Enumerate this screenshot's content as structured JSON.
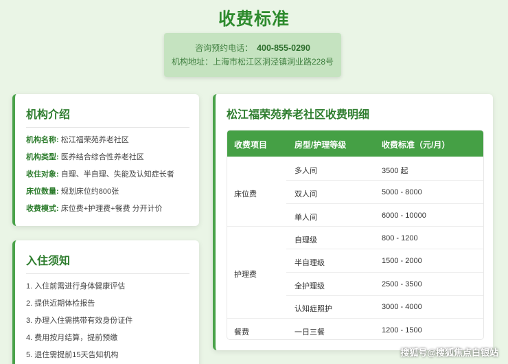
{
  "page_title": "收费标准",
  "contact": {
    "phone_label": "咨询预约电话：",
    "phone": "400-855-0290",
    "address_label": "机构地址：",
    "address": "上海市松江区洞泾镇洞业路228号"
  },
  "intro": {
    "title": "机构介绍",
    "rows": [
      {
        "key": "机构名称:",
        "value": "松江福荣苑养老社区"
      },
      {
        "key": "机构类型:",
        "value": "医养结合综合性养老社区"
      },
      {
        "key": "收住对象:",
        "value": "自理、半自理、失能及认知症长者"
      },
      {
        "key": "床位数量:",
        "value": "规划床位约800张"
      },
      {
        "key": "收费模式:",
        "value": "床位费+护理费+餐费 分开计价"
      }
    ]
  },
  "notice": {
    "title": "入住须知",
    "items": [
      "1. 入住前需进行身体健康评估",
      "2. 提供近期体检报告",
      "3. 办理入住需携带有效身份证件",
      "4. 费用按月结算，提前预缴",
      "5. 退住需提前15天告知机构"
    ]
  },
  "fees": {
    "title": "松江福荣苑养老社区收费明细",
    "headers": [
      "收费项目",
      "房型/护理等级",
      "收费标准（元/月）"
    ],
    "groups": [
      {
        "category": "床位费",
        "rows": [
          {
            "type": "多人间",
            "price": "3500 起"
          },
          {
            "type": "双人间",
            "price": "5000 - 8000"
          },
          {
            "type": "单人间",
            "price": "6000 - 10000"
          }
        ]
      },
      {
        "category": "护理费",
        "rows": [
          {
            "type": "自理级",
            "price": "800 - 1200"
          },
          {
            "type": "半自理级",
            "price": "1500 - 2000"
          },
          {
            "type": "全护理级",
            "price": "2500 - 3500"
          },
          {
            "type": "认知症照护",
            "price": "3000 - 4000"
          }
        ]
      },
      {
        "category": "餐费",
        "rows": [
          {
            "type": "一日三餐",
            "price": "1200 - 1500"
          }
        ]
      }
    ]
  },
  "watermark": "搜狐号@搜狐焦点白银站",
  "colors": {
    "accent": "#45a045",
    "title_green": "#2e8b2e",
    "background": "#eaf5e6"
  }
}
